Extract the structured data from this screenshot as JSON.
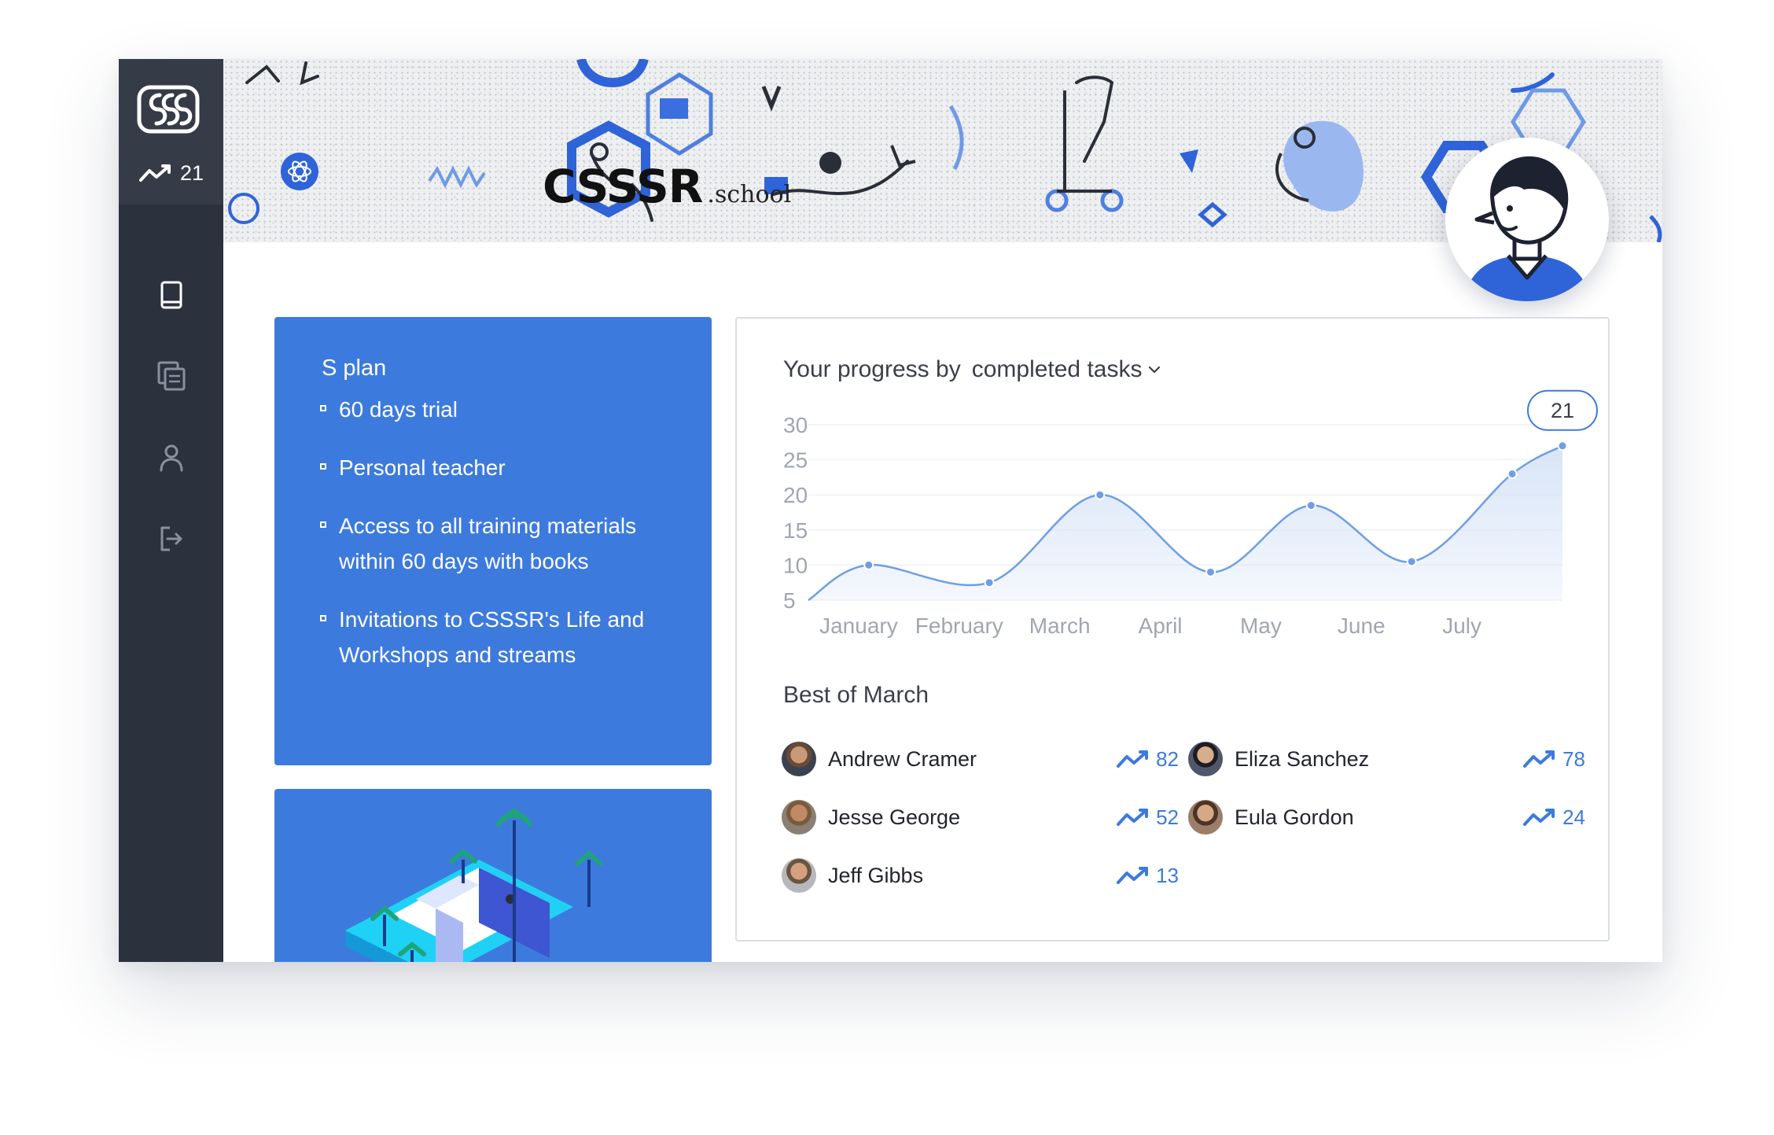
{
  "sidebar": {
    "score": "21",
    "nav": [
      {
        "name": "book-icon"
      },
      {
        "name": "copy-icon"
      },
      {
        "name": "user-icon"
      },
      {
        "name": "logout-icon"
      }
    ]
  },
  "header": {
    "brand_name": "CSSSR",
    "brand_suffix": ".school"
  },
  "plan": {
    "title": "S plan",
    "features": [
      "60 days trial",
      "Personal teacher",
      "Access to all training materials within 60 days with books",
      "Invitations to CSSSR's Life and Workshops and streams"
    ]
  },
  "progress": {
    "title": "Your progress by",
    "metric": "completed tasks",
    "current_badge": "21"
  },
  "chart_data": {
    "type": "area",
    "categories": [
      "January",
      "February",
      "March",
      "April",
      "May",
      "June",
      "July"
    ],
    "y_ticks": [
      "30",
      "25",
      "20",
      "15",
      "10",
      "5"
    ],
    "ylim": [
      5,
      30
    ],
    "grid": true,
    "points": [
      {
        "x": 0.0,
        "y": 5
      },
      {
        "x": 0.6,
        "y": 10
      },
      {
        "x": 1.8,
        "y": 7.5
      },
      {
        "x": 2.9,
        "y": 20
      },
      {
        "x": 4.0,
        "y": 9
      },
      {
        "x": 5.0,
        "y": 18.5
      },
      {
        "x": 6.0,
        "y": 10.5
      },
      {
        "x": 7.0,
        "y": 23
      },
      {
        "x": 7.5,
        "y": 27
      }
    ],
    "highlight": {
      "x": 7.5,
      "y": 27,
      "label": "21"
    }
  },
  "best": {
    "title": "Best of March",
    "people": [
      {
        "name": "Andrew Cramer",
        "score": "82"
      },
      {
        "name": "Eliza Sanchez",
        "score": "78"
      },
      {
        "name": "Jesse George",
        "score": "52"
      },
      {
        "name": "Eula Gordon",
        "score": "24"
      },
      {
        "name": "Jeff Gibbs",
        "score": "13"
      }
    ]
  },
  "colors": {
    "accent": "#3d7add",
    "sidebar": "#2b313d",
    "sidebar_top": "#353c48",
    "chart_line": "#6f9ee6",
    "chart_fill": "#d6e3f7"
  }
}
